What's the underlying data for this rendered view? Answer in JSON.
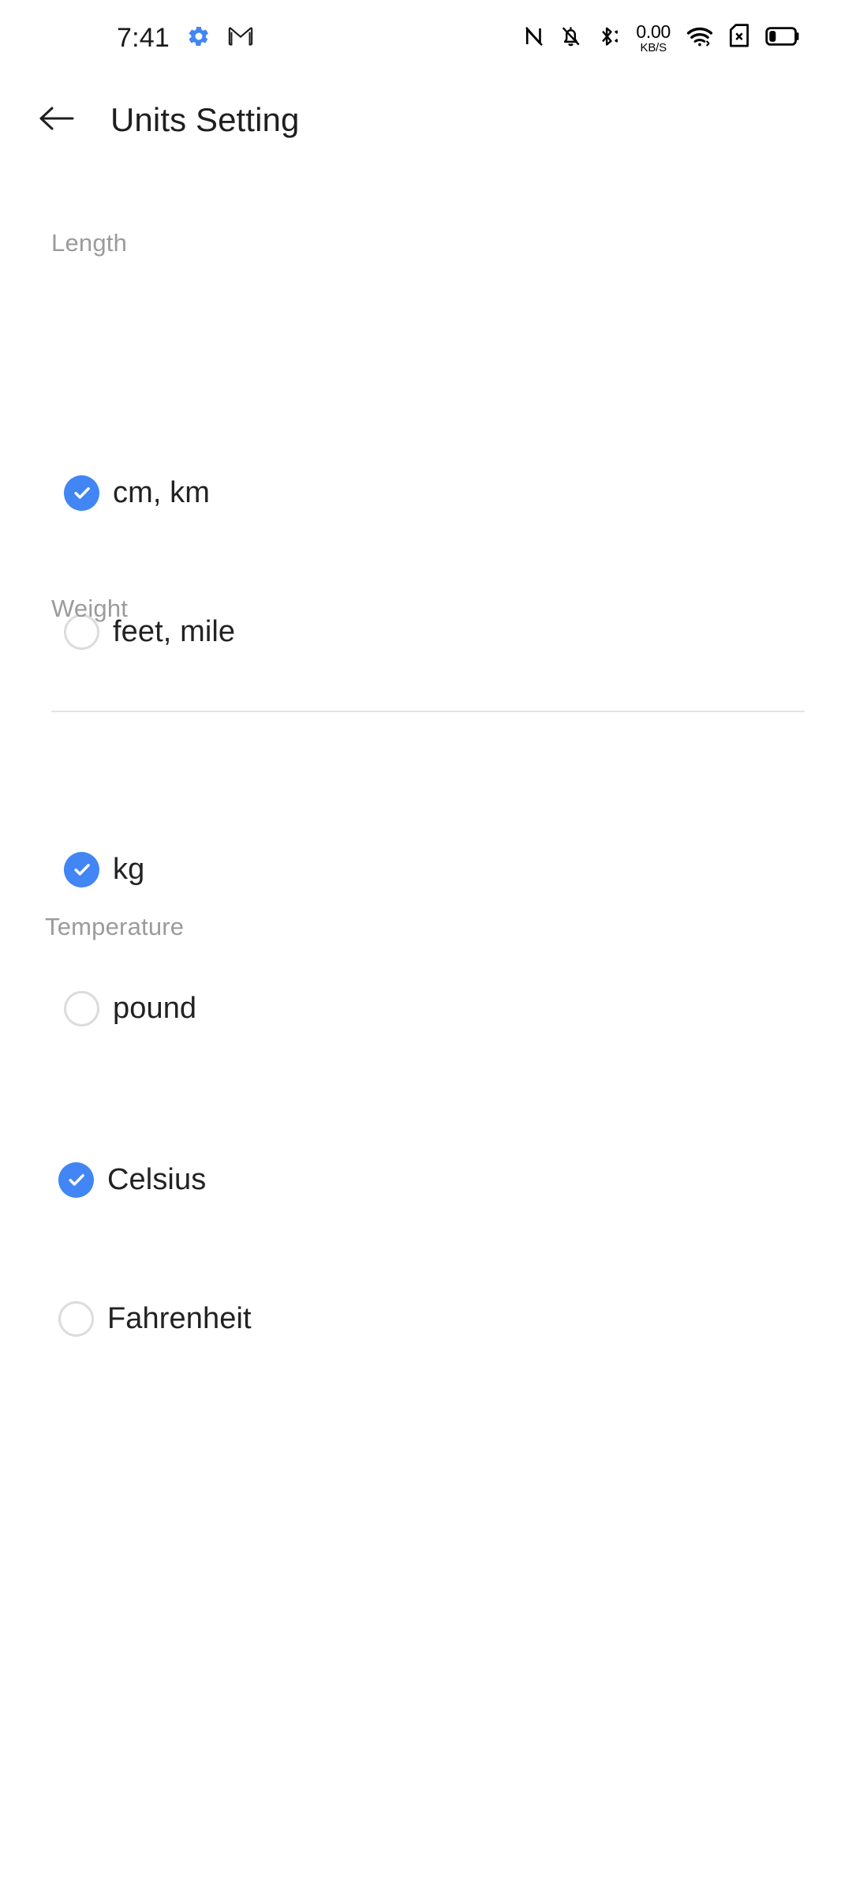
{
  "status_bar": {
    "clock": "7:41",
    "left_icons": [
      {
        "name": "settings-gear-icon",
        "color": "#4285f4"
      },
      {
        "name": "gmail-icon",
        "color": "#1a1a1a"
      }
    ],
    "right_icons": [
      {
        "name": "nfc-off-icon"
      },
      {
        "name": "notifications-silenced-icon"
      },
      {
        "name": "bluetooth-icon"
      },
      {
        "name": "wifi-icon"
      },
      {
        "name": "no-sim-card-icon"
      },
      {
        "name": "battery-low-icon"
      }
    ],
    "network_speed": {
      "value": "0.00",
      "unit": "KB/S"
    }
  },
  "app_bar": {
    "back_icon": "arrow-left-icon",
    "title": "Units Setting"
  },
  "colors": {
    "accent": "#4285f4",
    "section_label": "#9b9b9b",
    "option_label": "#222222",
    "radio_off_border": "#dcdcdc",
    "divider": "#e3e3e3",
    "background": "#ffffff"
  },
  "sections": [
    {
      "label": "Length",
      "options": [
        {
          "label": "cm, km",
          "selected": true
        },
        {
          "label": "feet, mile",
          "selected": false
        }
      ]
    },
    {
      "label": "Weight",
      "options": [
        {
          "label": "kg",
          "selected": true
        },
        {
          "label": "pound",
          "selected": false
        }
      ]
    },
    {
      "label": "Temperature",
      "options": [
        {
          "label": "Celsius",
          "selected": true
        },
        {
          "label": "Fahrenheit",
          "selected": false
        }
      ]
    }
  ]
}
